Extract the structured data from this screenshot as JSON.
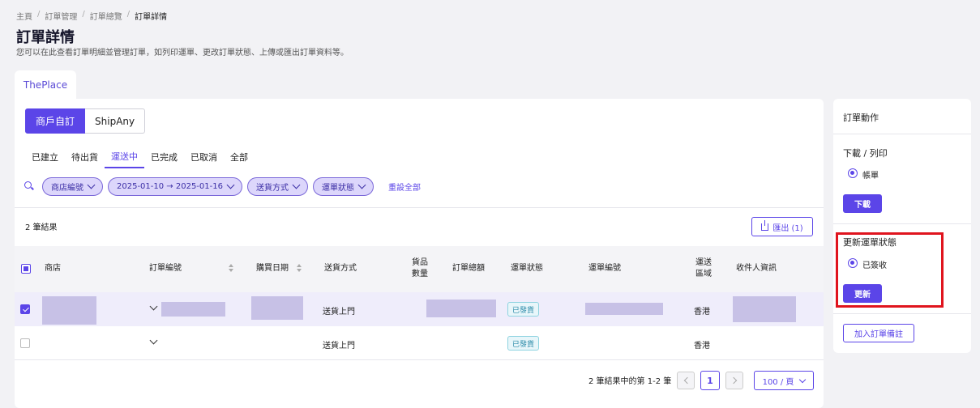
{
  "breadcrumb": [
    "主頁",
    "訂單管理",
    "訂單總覽",
    "訂單詳情"
  ],
  "page": {
    "title": "訂單詳情",
    "subtitle": "您可以在此查看訂單明細並管理訂單，如列印運單、更改訂單狀態、上傳或匯出訂單資料等。"
  },
  "store_tab": "ThePlace",
  "segmented": [
    "商戶自訂",
    "ShipAny"
  ],
  "status_tabs": [
    "已建立",
    "待出貨",
    "運送中",
    "已完成",
    "已取消",
    "全部"
  ],
  "active_status_tab": "運送中",
  "filters": {
    "chips": [
      "商店編號",
      "2025-01-10 → 2025-01-16",
      "送貨方式",
      "運單狀態"
    ],
    "reset_label": "重設全部"
  },
  "results_count": "2 筆結果",
  "export_label": "匯出 (1)",
  "table": {
    "headers": {
      "store": "商店",
      "order_no": "訂單編號",
      "purchase_date": "購買日期",
      "shipping_method": "送貨方式",
      "qty_line1": "貨品",
      "qty_line2": "數量",
      "total": "訂單總額",
      "waybill_status": "運單狀態",
      "waybill_no": "運單編號",
      "region_line1": "運送",
      "region_line2": "區域",
      "recipient": "收件人資訊"
    },
    "rows": [
      {
        "checked": true,
        "shipping_method": "送貨上門",
        "status": "已發貨",
        "region": "香港"
      },
      {
        "checked": false,
        "shipping_method": "送貨上門",
        "status": "已發貨",
        "region": "香港"
      }
    ]
  },
  "pagination": {
    "summary": "2 筆結果中的第 1-2 筆",
    "current_page": "1",
    "per_page": "100 / 頁"
  },
  "sidebar": {
    "title": "訂單動作",
    "download_section": {
      "heading": "下載 / 列印",
      "option": "帳單",
      "button": "下載"
    },
    "update_section": {
      "heading": "更新運單狀態",
      "option": "已簽收",
      "button": "更新"
    },
    "note_button": "加入訂單備註"
  },
  "colors": {
    "accent": "#5b45e8",
    "highlight": "#e0141e",
    "badge": "#2a8aa8"
  }
}
